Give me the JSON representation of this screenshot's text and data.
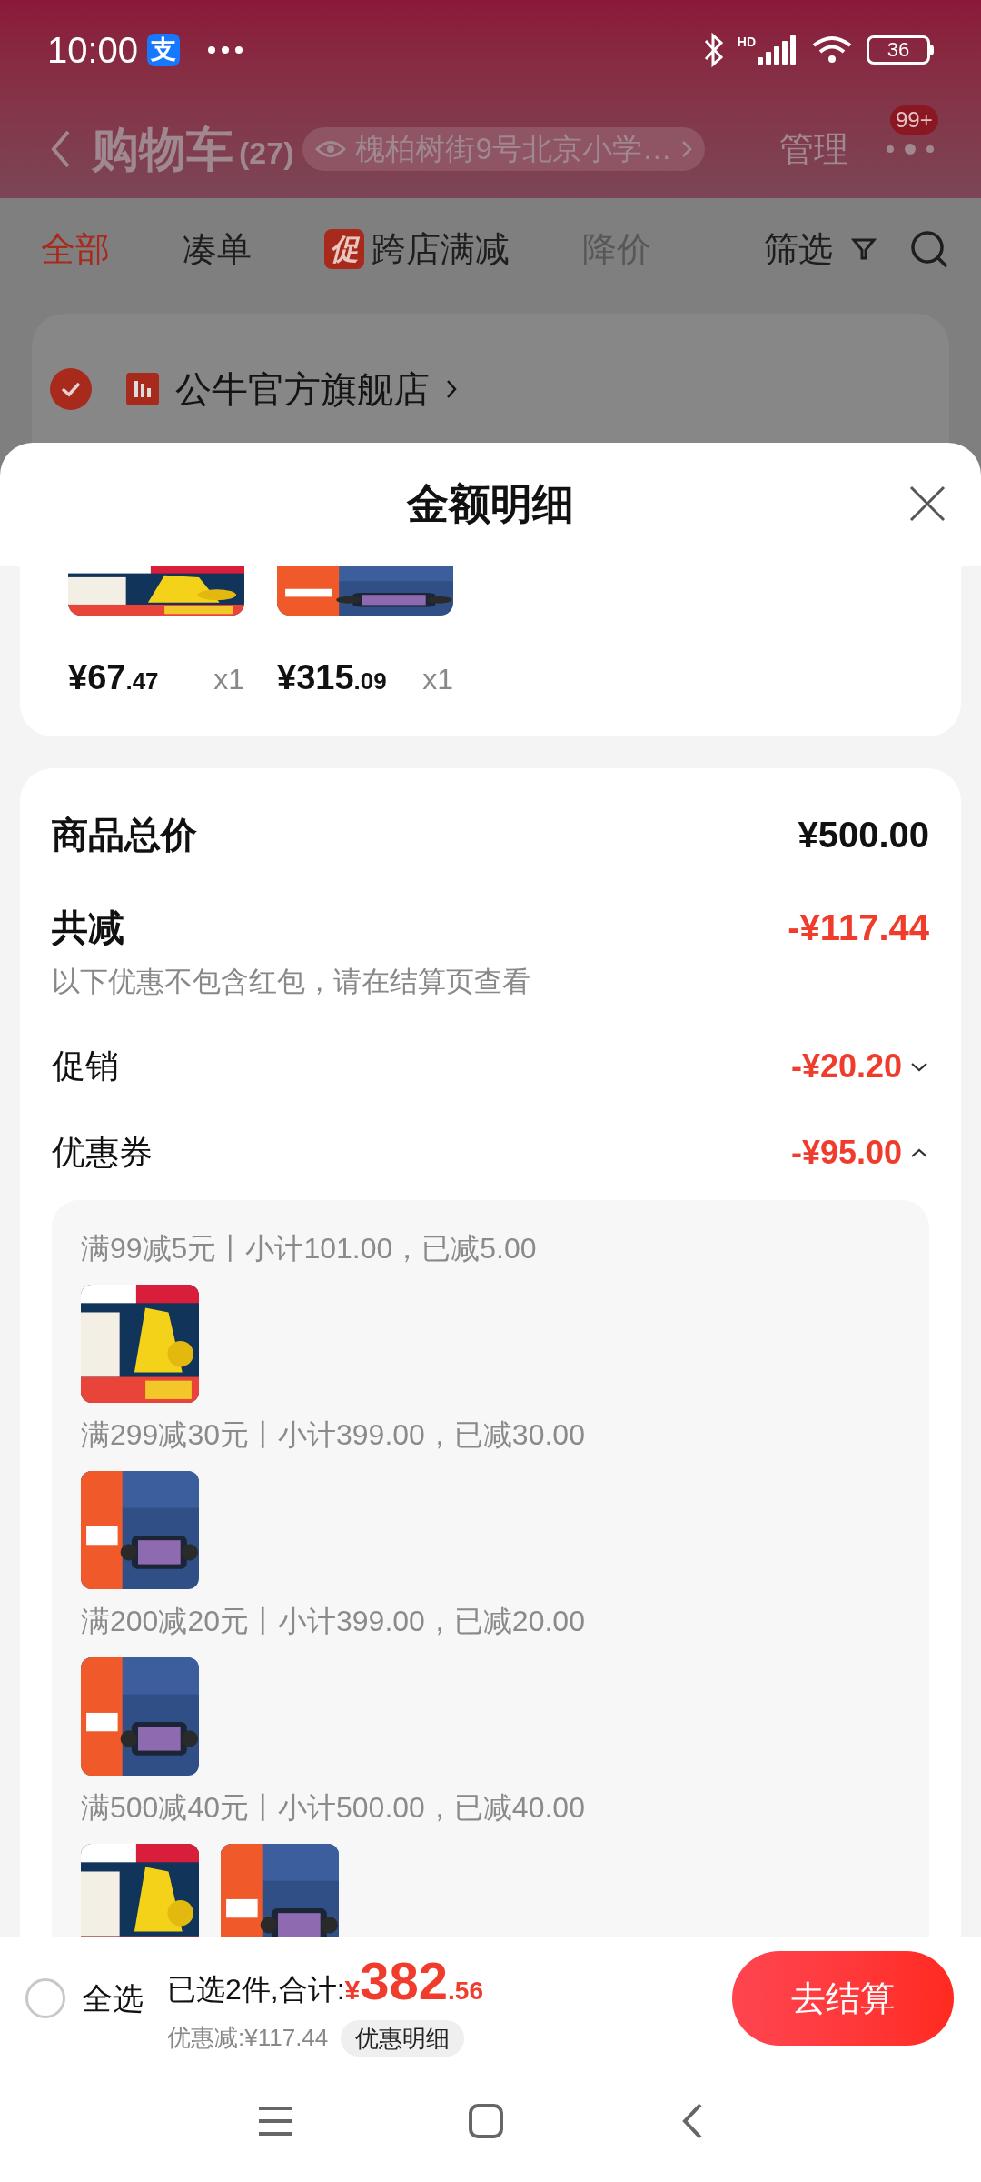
{
  "status_bar": {
    "time": "10:00",
    "app_badge": "支",
    "signal_label": "HD",
    "battery": "36"
  },
  "header": {
    "title": "购物车",
    "count": "(27)",
    "address": "槐柏树街9号北京小学…",
    "manage": "管理",
    "more_badge": "99+"
  },
  "tabs": [
    {
      "label": "全部",
      "selected": true,
      "disabled": false
    },
    {
      "label": "凑单",
      "selected": false,
      "disabled": false
    },
    {
      "label": "跨店满减",
      "selected": false,
      "disabled": false,
      "tag": "促"
    },
    {
      "label": "降价",
      "selected": false,
      "disabled": true
    }
  ],
  "filter": "筛选",
  "store": {
    "name": "公牛官方旗舰店",
    "checked": true
  },
  "sheet": {
    "title": "金额明细",
    "items": [
      {
        "kind": "picture",
        "price": "¥67",
        "cents": ".47",
        "qty": "x1"
      },
      {
        "kind": "picture",
        "price": "¥315",
        "cents": ".09",
        "qty": "x1"
      }
    ],
    "total": {
      "label": "商品总价",
      "value": "¥500.00"
    },
    "discount": {
      "label": "共减",
      "value": "-¥117.44",
      "note": "以下优惠不包含红包，请在结算页查看"
    },
    "rows": [
      {
        "label": "促销",
        "value": "-¥20.20",
        "expanded": false
      },
      {
        "label": "优惠券",
        "value": "-¥95.00",
        "expanded": true
      }
    ],
    "coupons": [
      {
        "text": "满99减5元丨小计101.00，已减5.00"
      },
      {
        "text": "满299减30元丨小计399.00，已减30.00"
      },
      {
        "text": "满200减20元丨小计399.00，已减20.00"
      },
      {
        "text": "满500减40元丨小计500.00，已减40.00"
      }
    ]
  },
  "bottom_bar": {
    "select_all": {
      "label": "全选",
      "checked": false
    },
    "summary": "已选2件,合计:",
    "currency": "¥",
    "amount": "382",
    "cents": ".56",
    "saving": "优惠减:¥117.44",
    "detail_button": "优惠明细",
    "checkout": "去结算"
  }
}
